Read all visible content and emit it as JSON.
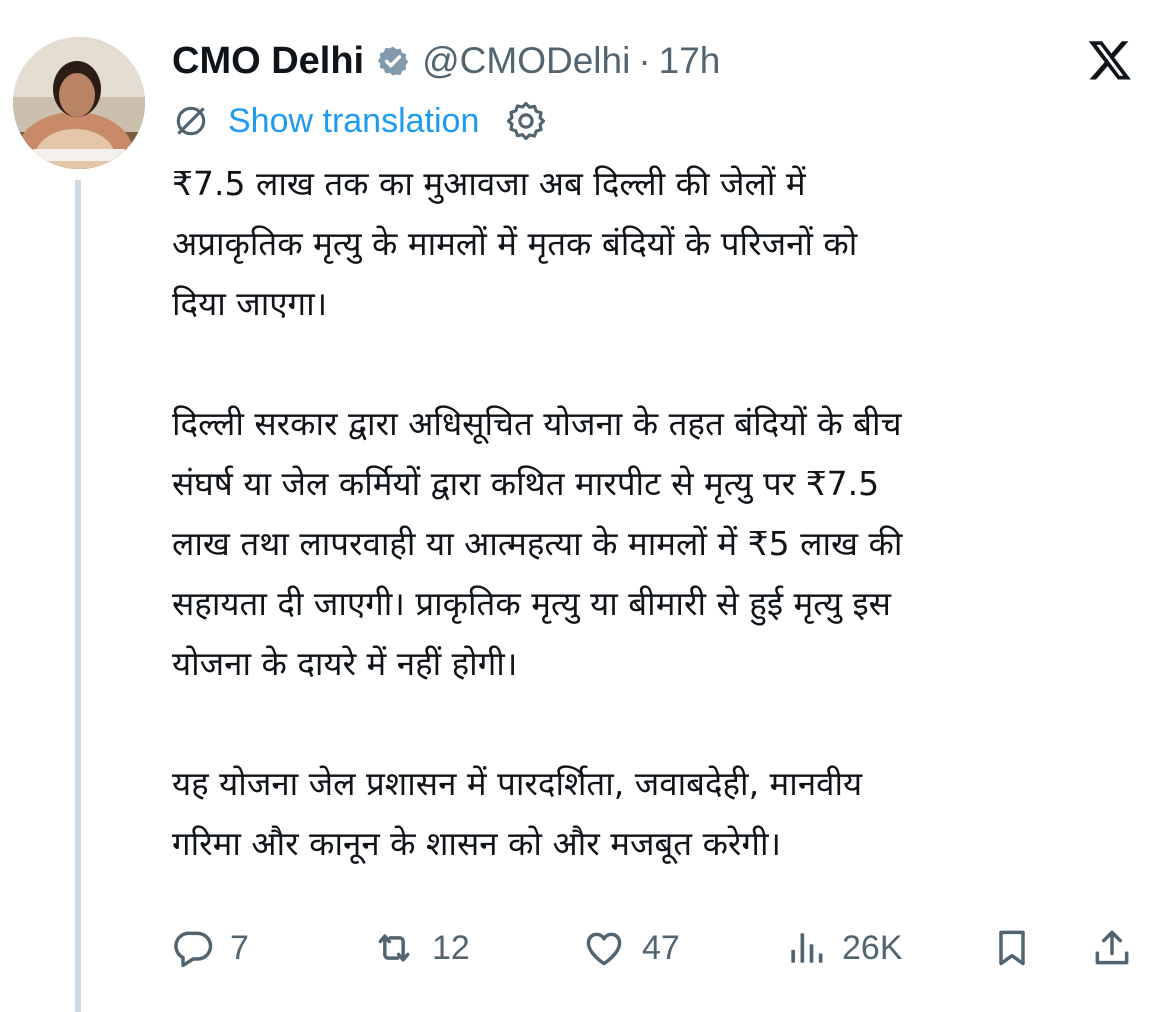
{
  "tweet": {
    "author_name": "CMO Delhi",
    "handle": "@CMODelhi",
    "separator": "·",
    "time": "17h",
    "translate_label": "Show translation",
    "lines": [
      "₹7.5 लाख तक का मुआवजा अब दिल्ली की जेलों में",
      "अप्राकृतिक मृत्यु के मामलों में मृतक बंदियों के परिजनों को",
      "दिया जाएगा।",
      "",
      "दिल्ली सरकार द्वारा अधिसूचित योजना के तहत बंदियों के बीच",
      "संघर्ष या जेल कर्मियों द्वारा कथित मारपीट से मृत्यु पर ₹7.5",
      "लाख तथा लापरवाही या आत्महत्या के मामलों में ₹5 लाख की",
      "सहायता दी जाएगी। प्राकृतिक मृत्यु या बीमारी से हुई मृत्यु इस",
      "योजना के दायरे में नहीं होगी।",
      "",
      "यह योजना जेल प्रशासन में पारदर्शिता, जवाबदेही, मानवीय",
      "गरिमा और कानून के शासन को और मजबूत करेगी।"
    ]
  },
  "actions": {
    "replies": "7",
    "reposts": "12",
    "likes": "47",
    "views": "26K"
  },
  "colors": {
    "text": "#0f1419",
    "muted": "#536471",
    "link": "#1d9bf0",
    "thread_line": "#cfd9de"
  },
  "icons": [
    "verified-badge-icon",
    "x-logo-icon",
    "translate-icon",
    "gear-icon",
    "reply-icon",
    "repost-icon",
    "like-icon",
    "views-icon",
    "bookmark-icon",
    "share-icon"
  ]
}
